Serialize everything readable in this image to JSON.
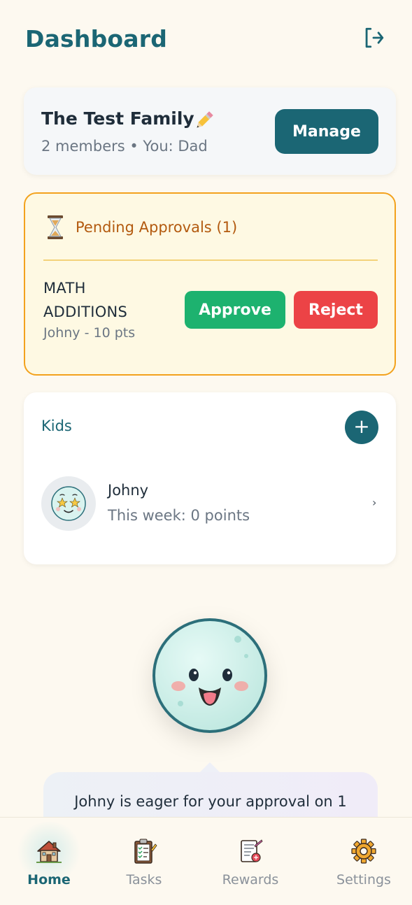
{
  "header": {
    "title": "Dashboard",
    "logout_icon": "logout-icon"
  },
  "family": {
    "name": "The Test Family",
    "meta": "2 members • You: Dad",
    "manage_label": "Manage",
    "edit_icon": "pencil-icon"
  },
  "pending": {
    "title": "Pending Approvals (1)",
    "icon": "hourglass-icon",
    "items": [
      {
        "task": "MATH ADDITIONS",
        "meta": "Johny - 10 pts",
        "approve_label": "Approve",
        "reject_label": "Reject"
      }
    ]
  },
  "kids": {
    "title": "Kids",
    "add_label": "+",
    "list": [
      {
        "name": "Johny",
        "points": "This week: 0 points",
        "chevron": "›"
      }
    ]
  },
  "mascot": {
    "message": "Johny is eager for your approval on 1"
  },
  "nav": {
    "items": [
      {
        "label": "Home",
        "icon": "house-icon",
        "active": true
      },
      {
        "label": "Tasks",
        "icon": "clipboard-icon",
        "active": false
      },
      {
        "label": "Rewards",
        "icon": "scorecard-icon",
        "active": false
      },
      {
        "label": "Settings",
        "icon": "gear-icon",
        "active": false
      }
    ]
  },
  "colors": {
    "primary": "#1b6674",
    "background": "#fdf9f0",
    "approve": "#1db26f",
    "reject": "#ec4346",
    "pending_border": "#f3a21d",
    "pending_bg": "#fef9e3"
  }
}
